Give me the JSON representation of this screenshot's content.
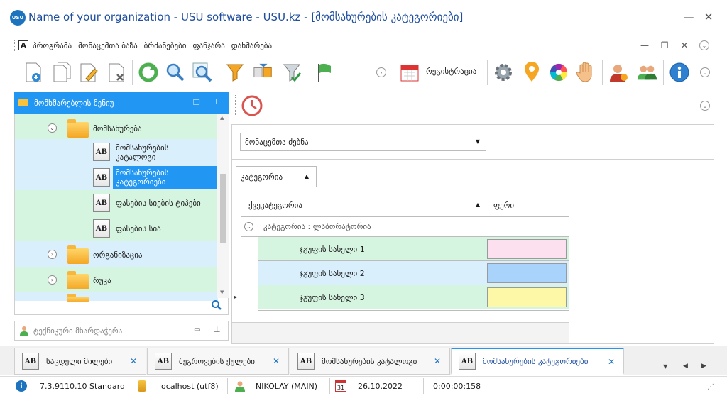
{
  "window": {
    "title": "Name of your organization - USU software - USU.kz - [მომსახურების კატეგორიები]",
    "logo_text": "USU",
    "minimize": "—",
    "close": "✕"
  },
  "menu": {
    "items": [
      "პროგრამა",
      "მონაცემთა ბაზა",
      "ბრძანებები",
      "ფანჯარა",
      "დახმარება"
    ]
  },
  "toolbar": {
    "register_label": "რეგისტრაცია"
  },
  "left_panel": {
    "header": "მომხმარებლის მენიუ",
    "tree": [
      {
        "label": "მომსახურება",
        "type": "folder",
        "expanded": true
      },
      {
        "label": "მომსახურების კატალოგი",
        "type": "item"
      },
      {
        "label": "მომსახურების კატეგორიები",
        "type": "item",
        "selected": true
      },
      {
        "label": "ფასების სიების ტიპები",
        "type": "item"
      },
      {
        "label": "ფასების სია",
        "type": "item"
      },
      {
        "label": "ორგანიზაცია",
        "type": "folder"
      },
      {
        "label": "რუკა",
        "type": "folder"
      }
    ],
    "tech_panel": "ტექნიკური მხარდაჭერა"
  },
  "content": {
    "db_dropdown": "მონაცემთა ძებნა",
    "group_by": "კატეგორია",
    "columns": [
      "ქვეკატეგორია",
      "ფერი"
    ],
    "group_row": "კატეგორია : ლაბორატორია",
    "rows": [
      {
        "name": "ჯგუფის სახელი 1",
        "color": "#fde0ef"
      },
      {
        "name": "ჯგუფის სახელი 2",
        "color": "#a9d3fb"
      },
      {
        "name": "ჯგუფის სახელი 3",
        "color": "#fdf8a8"
      }
    ]
  },
  "tabs": [
    {
      "label": "საცდელი მილები",
      "icon": "AB"
    },
    {
      "label": "შეგროვების ქულები",
      "icon": "AB"
    },
    {
      "label": "მომსახურების კატალოგი",
      "icon": "AB"
    },
    {
      "label": "მომსახურების კატეგორიები",
      "icon": "AB",
      "active": true
    }
  ],
  "status": {
    "version": "7.3.9110.10 Standard",
    "db": "localhost (utf8)",
    "user": "NIKOLAY (MAIN)",
    "date": "26.10.2022",
    "timer": "0:00:00:158",
    "calendar_day": "31"
  },
  "colors": {
    "accent": "#2196f3",
    "title_text": "#1f4e9e",
    "tree_bg_light": "#d9effc",
    "tree_bg_green": "#d6f5e1",
    "selected": "#2196f3"
  }
}
